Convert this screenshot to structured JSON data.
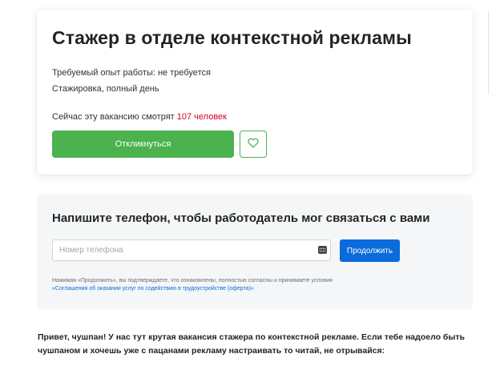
{
  "vacancy": {
    "title": "Стажер в отделе контекстной рекламы",
    "experience": "Требуемый опыт работы: не требуется",
    "employment": "Стажировка, полный день",
    "viewers_prefix": "Сейчас эту вакансию смотрят ",
    "viewers_count": "107 человек",
    "respond_label": "Откликнуться",
    "favorite_icon": "heart-outline-icon"
  },
  "phone_form": {
    "heading": "Напишите телефон, чтобы работодатель мог связаться с вами",
    "placeholder": "Номер телефона",
    "input_icon": "keyboard-icon",
    "continue_label": "Продолжить",
    "terms_text": "Нажимая «Продолжить», вы подтверждаете, что ознакомлены, полностью согласны и принимаете условия",
    "terms_link": "«Соглашения об оказании услуг по содействию в трудоустройстве (оферта)»"
  },
  "description": {
    "intro": "Привет, чушпан! У нас тут крутая вакансия стажера по контекстной рекламе. Если тебе надоело быть чушпаном и хочешь уже с пацанами рекламу настраивать то читай, не отрывайся:"
  },
  "colors": {
    "accent_green": "#4bb24e",
    "link_blue": "#0a6bdc",
    "count_red": "#d6001c",
    "panel_bg": "#f4f6f7"
  }
}
